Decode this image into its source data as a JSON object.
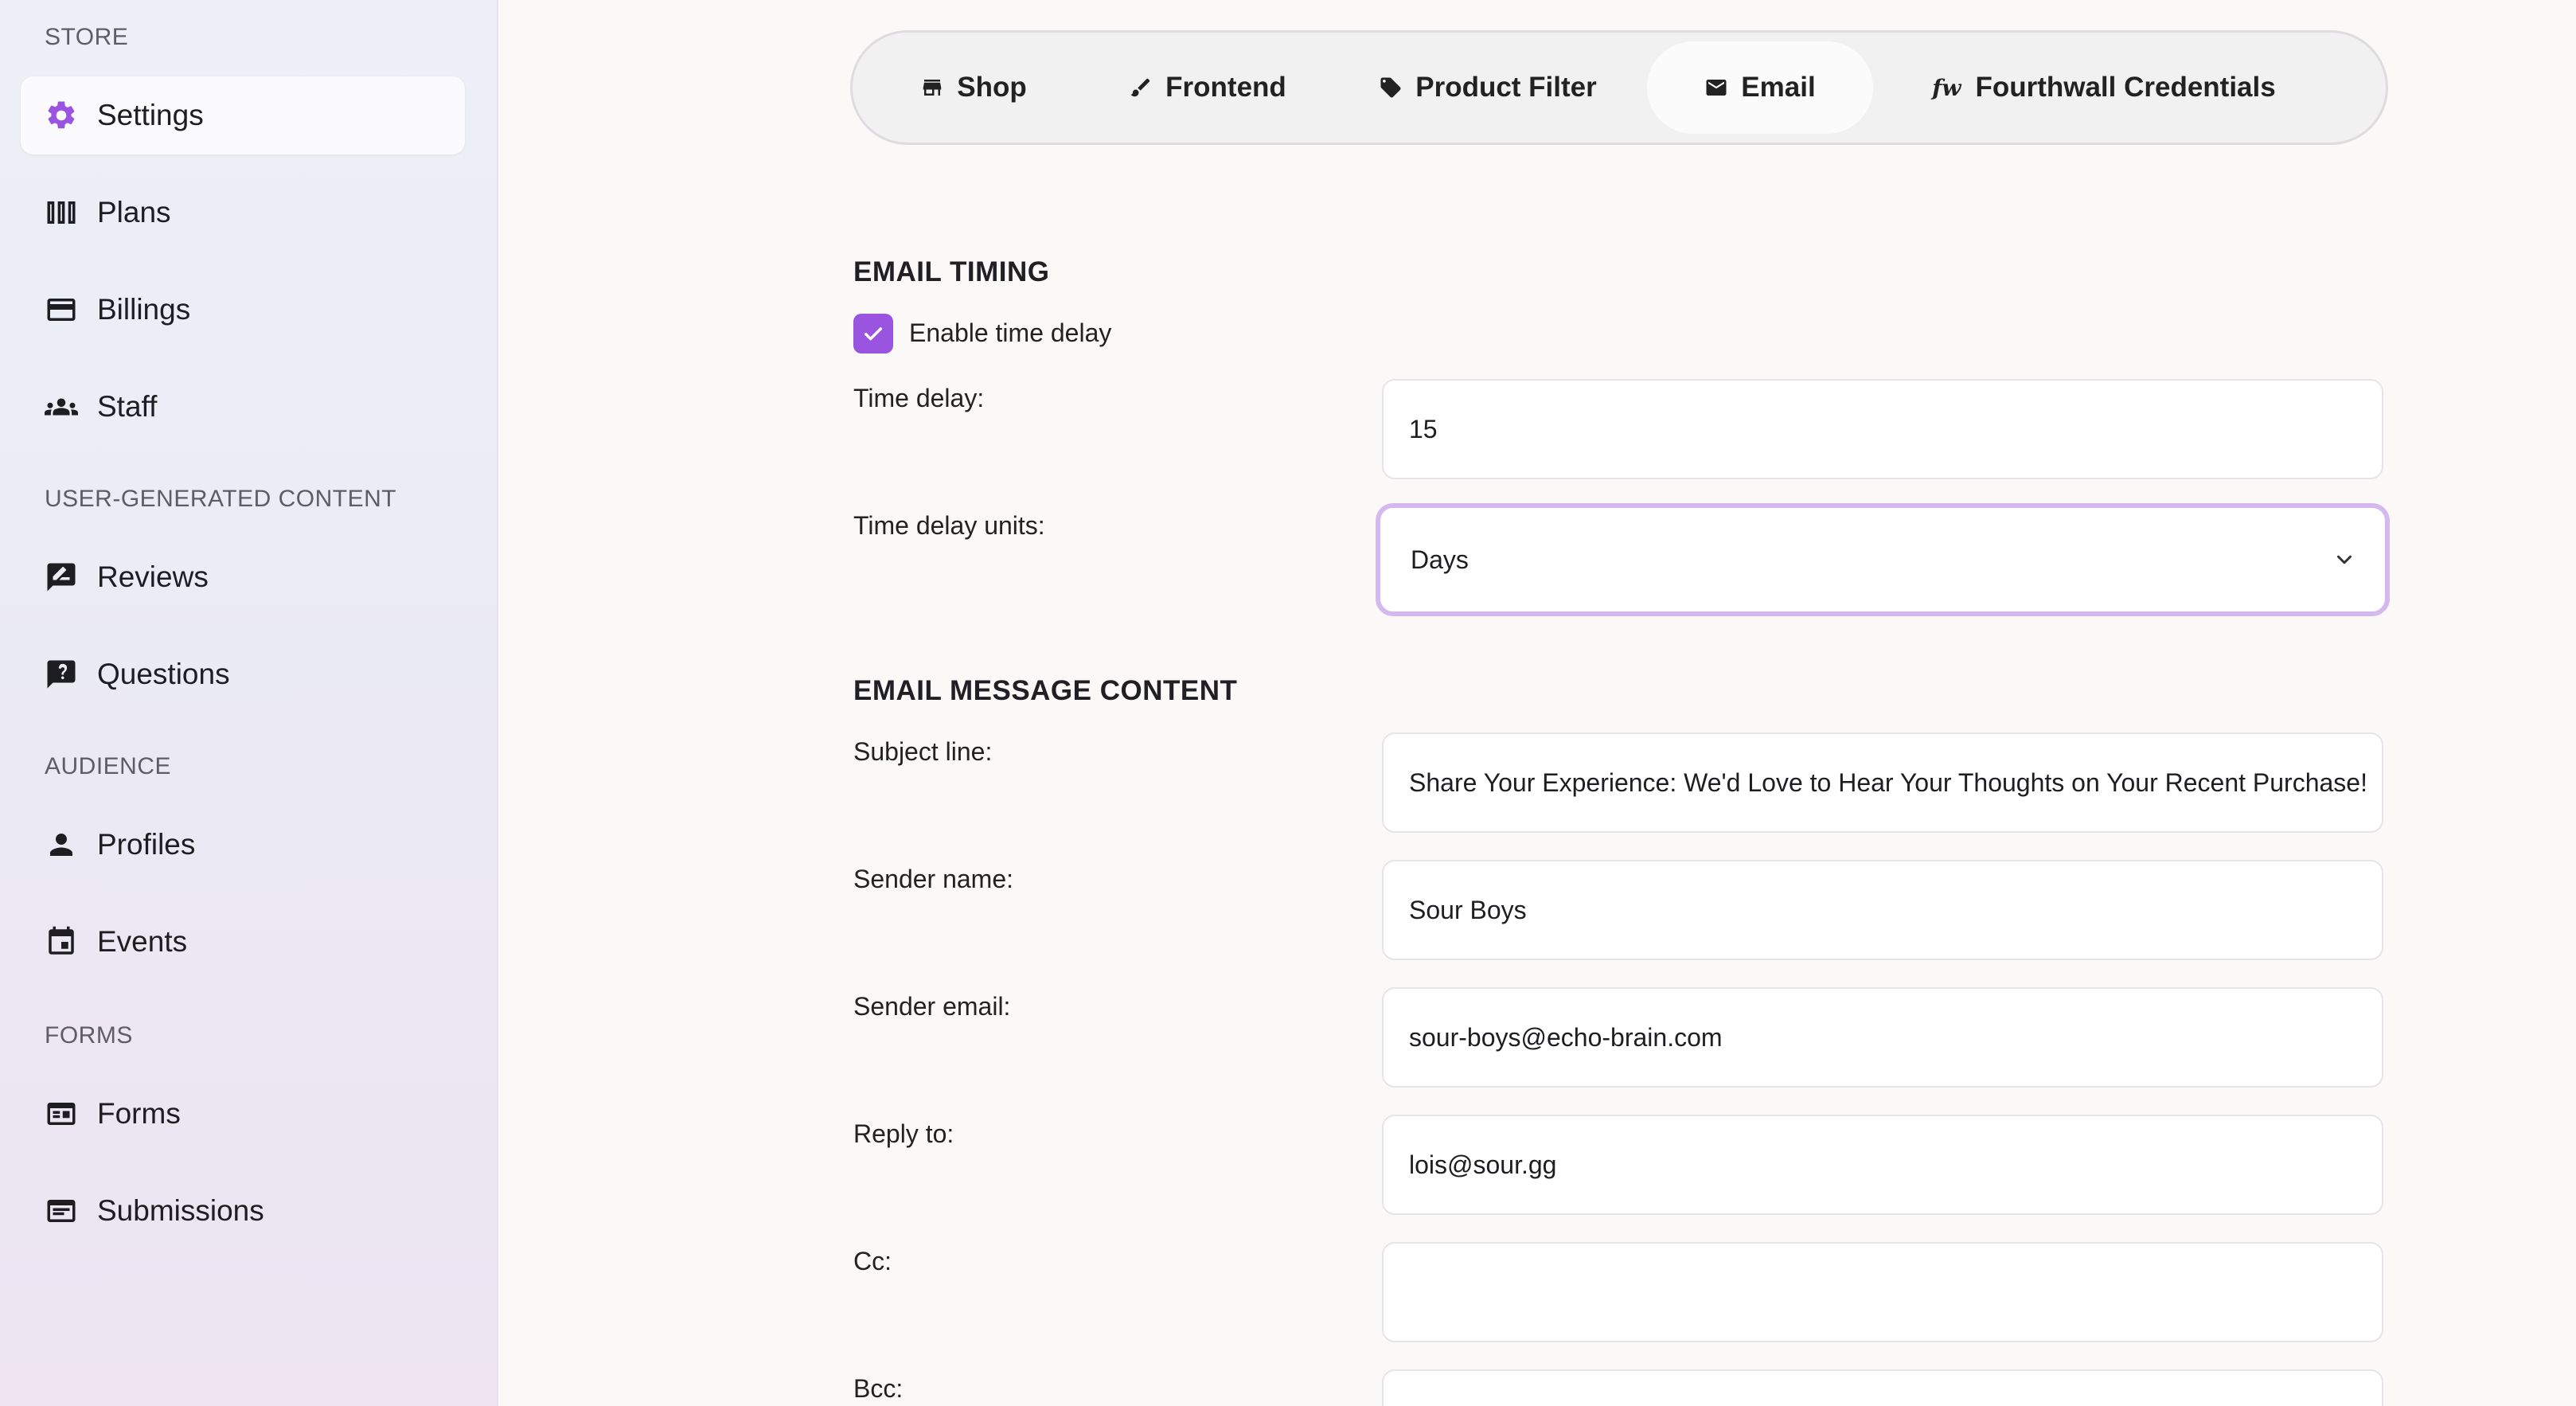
{
  "sidebar": {
    "sections": {
      "store": "STORE",
      "ugc": "USER-GENERATED CONTENT",
      "audience": "AUDIENCE",
      "forms": "FORMS"
    },
    "items": [
      {
        "label": "Settings",
        "icon": "gear-icon",
        "active": true
      },
      {
        "label": "Plans",
        "icon": "columns-icon"
      },
      {
        "label": "Billings",
        "icon": "credit-card-icon"
      },
      {
        "label": "Staff",
        "icon": "group-icon"
      },
      {
        "label": "Reviews",
        "icon": "rate-review-icon"
      },
      {
        "label": "Questions",
        "icon": "question-icon"
      },
      {
        "label": "Profiles",
        "icon": "person-icon"
      },
      {
        "label": "Events",
        "icon": "calendar-icon"
      },
      {
        "label": "Forms",
        "icon": "form-icon"
      },
      {
        "label": "Submissions",
        "icon": "submissions-icon"
      }
    ]
  },
  "tabs": [
    {
      "label": "Shop",
      "icon": "store-icon"
    },
    {
      "label": "Frontend",
      "icon": "brush-icon"
    },
    {
      "label": "Product Filter",
      "icon": "tag-icon"
    },
    {
      "label": "Email",
      "icon": "mail-icon",
      "active": true
    },
    {
      "label": "Fourthwall Credentials",
      "icon": "fourthwall-icon",
      "icon_text": "fw"
    }
  ],
  "email_timing": {
    "heading": "EMAIL TIMING",
    "enable_delay_label": "Enable time delay",
    "enable_delay_checked": true,
    "time_delay_label": "Time delay:",
    "time_delay_value": "15",
    "units_label": "Time delay units:",
    "units_value": "Days"
  },
  "message_content": {
    "heading": "EMAIL MESSAGE CONTENT",
    "subject_label": "Subject line:",
    "subject_value": "Share Your Experience: We'd Love to Hear Your Thoughts on Your Recent Purchase!",
    "sender_name_label": "Sender name:",
    "sender_name_value": "Sour Boys",
    "sender_email_label": "Sender email:",
    "sender_email_value": "sour-boys@echo-brain.com",
    "reply_to_label": "Reply to:",
    "reply_to_value": "lois@sour.gg",
    "cc_label": "Cc:",
    "cc_value": "",
    "bcc_label": "Bcc:",
    "bcc_value": ""
  },
  "colors": {
    "accent": "#9a55e0",
    "focus_ring": "#d4b8ee"
  }
}
